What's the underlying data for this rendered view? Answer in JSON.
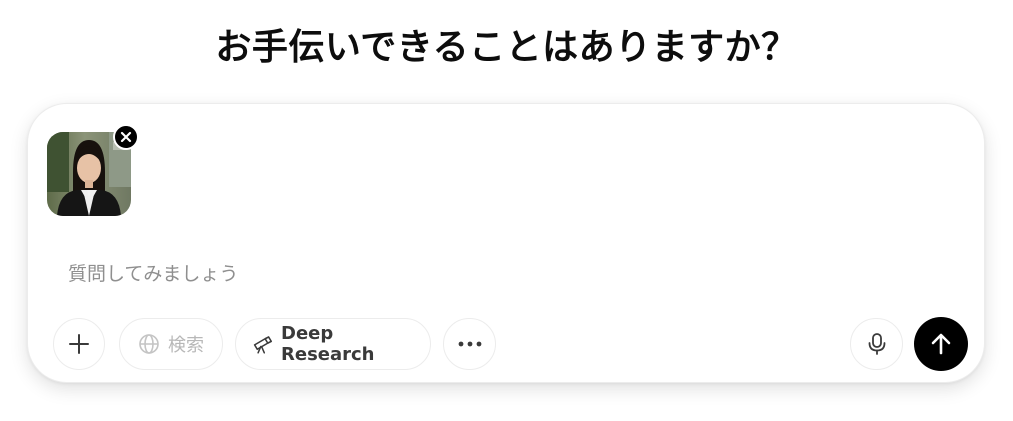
{
  "heading": "お手伝いできることはありますか？",
  "attachment": {
    "icon": "attached-photo-thumbnail",
    "remove_icon": "close-icon"
  },
  "composer": {
    "placeholder": "質問してみましょう",
    "value": ""
  },
  "toolbar": {
    "add_icon": "plus-icon",
    "search_label": "検索",
    "search_icon": "globe-icon",
    "deep_research_label": "Deep Research",
    "deep_research_icon": "telescope-icon",
    "more_icon": "ellipsis-icon",
    "mic_icon": "microphone-icon",
    "send_icon": "arrow-up-icon"
  },
  "colors": {
    "send_button": "#000000",
    "search_disabled_text": "#b8b8b8",
    "placeholder": "#8f8f8f"
  }
}
